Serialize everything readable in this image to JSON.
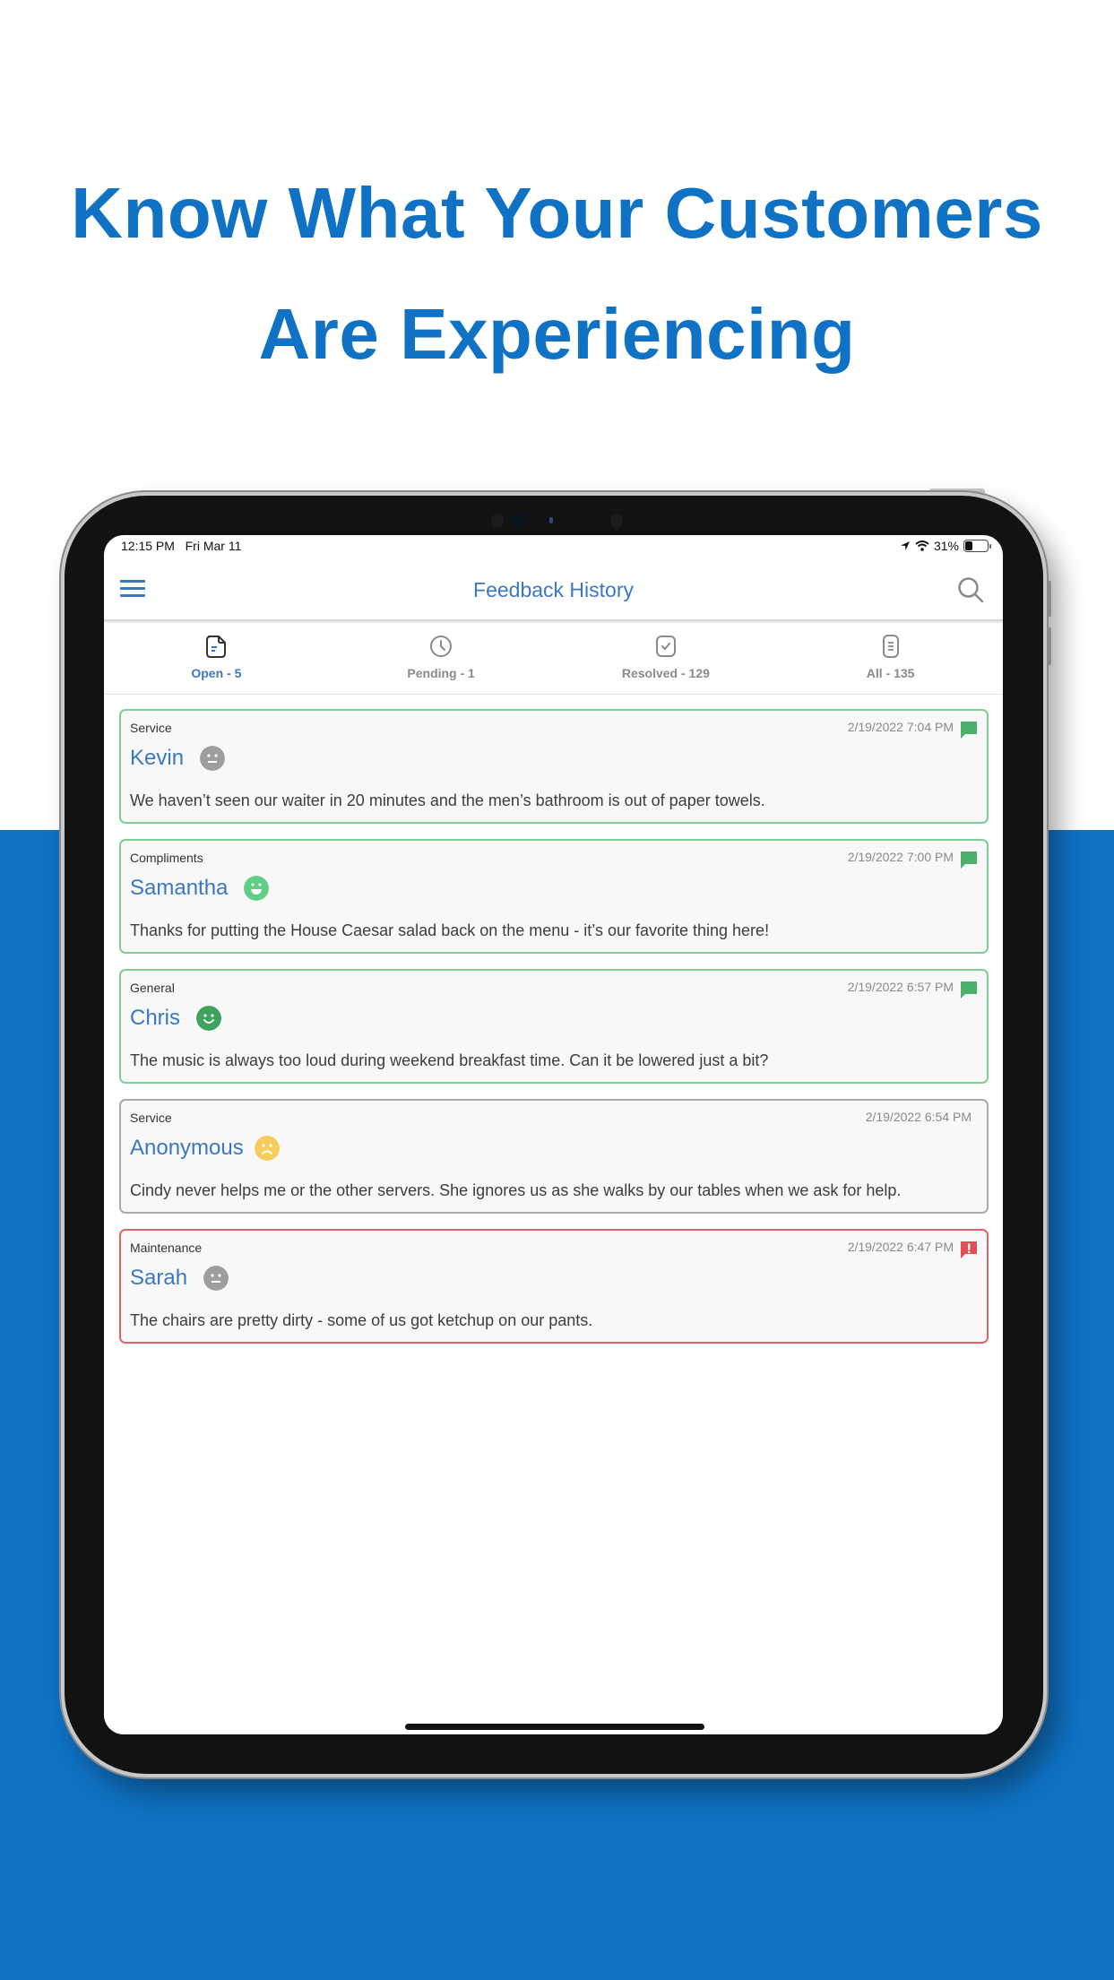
{
  "promo": {
    "headline_line1": "Know What Your Customers",
    "headline_line2": "Are Experiencing",
    "brand_color": "#0f72c4"
  },
  "status_bar": {
    "time": "12:15 PM",
    "date": "Fri Mar 11",
    "battery_percent": "31%",
    "battery_level": 0.31
  },
  "header": {
    "title": "Feedback History",
    "menu_icon": "hamburger-menu-icon",
    "search_icon": "search-icon"
  },
  "tabs": [
    {
      "label": "Open - 5",
      "icon": "document-icon",
      "active": true
    },
    {
      "label": "Pending - 1",
      "icon": "clock-icon",
      "active": false
    },
    {
      "label": "Resolved - 129",
      "icon": "check-square-icon",
      "active": false
    },
    {
      "label": "All - 135",
      "icon": "list-document-icon",
      "active": false
    }
  ],
  "feedback": [
    {
      "category": "Service",
      "timestamp": "2/19/2022 7:04 PM",
      "name": "Kevin",
      "sentiment": "neutral",
      "message": "We haven’t seen our waiter in 20 minutes and the men’s bathroom is out of paper towels.",
      "status": "open",
      "flag": "green-chat-icon"
    },
    {
      "category": "Compliments",
      "timestamp": "2/19/2022 7:00 PM",
      "name": "Samantha",
      "sentiment": "very-happy",
      "message": "Thanks for putting the House Caesar salad back on the menu - it’s our favorite thing here!",
      "status": "open",
      "flag": "green-chat-icon"
    },
    {
      "category": "General",
      "timestamp": "2/19/2022 6:57 PM",
      "name": "Chris",
      "sentiment": "happy",
      "message": "The music is always too loud during weekend breakfast time. Can it be lowered just a bit?",
      "status": "open",
      "flag": "green-chat-icon"
    },
    {
      "category": "Service",
      "timestamp": "2/19/2022 6:54 PM",
      "name": "Anonymous",
      "sentiment": "sad",
      "message": "Cindy never helps me or the other servers. She ignores us as she walks by our tables when we ask for help.",
      "status": "neutral",
      "flag": null
    },
    {
      "category": "Maintenance",
      "timestamp": "2/19/2022 6:47 PM",
      "name": "Sarah",
      "sentiment": "neutral",
      "message": "The chairs are pretty dirty - some of us got ketchup on our pants.",
      "status": "alert",
      "flag": "red-alert-chat-icon"
    }
  ],
  "colors": {
    "accent": "#3a78c3",
    "open_border": "#7dcf94",
    "neutral_border": "#a9a9a9",
    "alert_border": "#e06464",
    "flag_green": "#4caf6a",
    "flag_red": "#e05252",
    "face_neutral": "#9e9e9e",
    "face_very_happy": "#5fcf86",
    "face_happy": "#3da35d",
    "face_sad": "#f5cd5c"
  }
}
